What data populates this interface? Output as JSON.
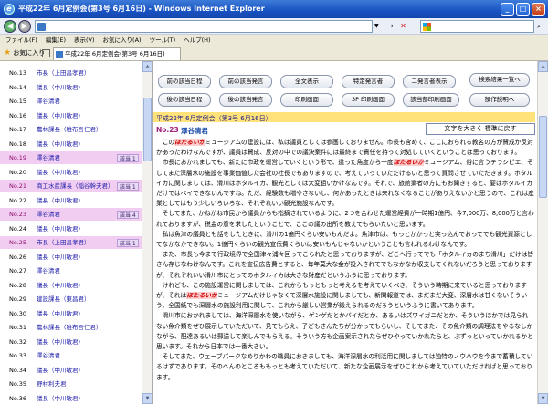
{
  "window": {
    "title": "平成22年 6月定例会(第3号 6月16日) - Windows Internet Explorer"
  },
  "address": {
    "url": ""
  },
  "menu": [
    "ファイル(F)",
    "編集(E)",
    "表示(V)",
    "お気に入り(A)",
    "ツール(T)",
    "ヘルプ(H)"
  ],
  "favorites": {
    "label": "お気に入り",
    "tab_title": "平成22年 6月定例会(第3号 6月16日)"
  },
  "sidebar": {
    "rows": [
      {
        "no": "No.13",
        "name": "市長（上田昌孝君）",
        "tag": ""
      },
      {
        "no": "No.14",
        "name": "議長（中川敏君）",
        "tag": ""
      },
      {
        "no": "No.15",
        "name": "澤谷清君",
        "tag": ""
      },
      {
        "no": "No.16",
        "name": "議長（中川敏君）",
        "tag": ""
      },
      {
        "no": "No.17",
        "name": "農林課長（稚布吾仁君）",
        "tag": ""
      },
      {
        "no": "No.18",
        "name": "議長（中川敏君）",
        "tag": ""
      },
      {
        "no": "No.19",
        "name": "澤谷清君",
        "tag": "該当 1"
      },
      {
        "no": "No.20",
        "name": "議長（中川敏君）",
        "tag": ""
      },
      {
        "no": "No.21",
        "name": "商工水産課長（稲谷幹夫君）",
        "tag": "該当 1"
      },
      {
        "no": "No.22",
        "name": "議長（中川敏君）",
        "tag": ""
      },
      {
        "no": "No.23",
        "name": "澤谷清君",
        "tag": "該当 4"
      },
      {
        "no": "No.24",
        "name": "議長（中川敏君）",
        "tag": ""
      },
      {
        "no": "No.25",
        "name": "市長（上田昌孝君）",
        "tag": "該当 1"
      },
      {
        "no": "No.26",
        "name": "議長（中川敏君）",
        "tag": ""
      },
      {
        "no": "No.27",
        "name": "澤谷清君",
        "tag": ""
      },
      {
        "no": "No.28",
        "name": "議長（中川敏君）",
        "tag": ""
      },
      {
        "no": "No.29",
        "name": "建設課長（東昌君）",
        "tag": ""
      },
      {
        "no": "No.30",
        "name": "議長（中川敏君）",
        "tag": ""
      },
      {
        "no": "No.31",
        "name": "農林課長（稚布吾仁君）",
        "tag": ""
      },
      {
        "no": "No.32",
        "name": "議長（中川敏君）",
        "tag": ""
      },
      {
        "no": "No.33",
        "name": "澤谷清君",
        "tag": ""
      },
      {
        "no": "No.34",
        "name": "議長（中川敏君）",
        "tag": ""
      },
      {
        "no": "No.35",
        "name": "野村利夫君",
        "tag": ""
      },
      {
        "no": "No.36",
        "name": "議長（中川敏君）",
        "tag": ""
      }
    ],
    "highlighted": [
      "No.19",
      "No.21",
      "No.23",
      "No.25"
    ]
  },
  "toolbar": {
    "prev_day": "前の該当日程",
    "prev_speaker": "前の該当発言",
    "show_all": "全文表示",
    "specific_speaker": "特定発言者",
    "two_speakers": "二発言者表示",
    "results_list": "検索結果一覧へ",
    "next_day": "後の該当日程",
    "next_speaker": "後の該当発言",
    "print_screen": "印刷画面",
    "print_all": "3P 印刷画面",
    "print_matched": "該当部印刷画面",
    "help": "操作説明へ"
  },
  "content": {
    "session": "平成22年 6月定例会（第3号 6月16日）",
    "speaker_no": "No.23",
    "speaker_name": "澤谷清君",
    "font_toggle": "文字を大きく 標準に戻す",
    "highlight_word": "ほたるいか",
    "paragraphs": [
      "この|ほたるいか|ミュージアムの建設には、私は議員としては参画しておりません。市長も含めて、ここにおられる教名の方が賛成か反対かあったわけなんですが、議員は賛成、反対の中での議決案件には最終まで責任を持って対処していくということは思っております。",
      "市長におかれましても、新たに市政を運営していくという形で、違った角度から一度|ほたるいか|ミュージアム、俗に言うテラシピエ、そしてまた深層水の施設を事業価値した会社の社長でもありますので、考えていっていただけるいと思って質問させていただきます。ホタルイカに関しましては、滑川はホタルイカ、観光としては大変狙いかけなんです。それで、旅館業者の方にもお聞きすると、要はホタルイカだけではペイできないんですね。ただ、経験数も増やさないし、何かあったときは来れなくなることがありえないかと思うので、これは産業としてはもう少しいろいろな、それぞれいい観光施設なんです。",
      "そしてまた、かねがね市民から議員からも指摘されているように、2つを合わせた運営経費が一時期1億円、今7,000万、8,000万と言われておりますが、税金の意を求したということで、ここの議の出所を教えてもらいたいと思います。",
      "私は魚津の議員とも話をしたときに、滑川の1億円くらい安いもんだよ。魚津市は、もっとかかっと突っ込んでおってでも観光資源としてなかなかできない。1億円くらいの観光宣伝費くらいは安いもんじゃないかということも言われるわけなんです。",
      "また、市長も今まで行政境界で全国津々浦々回ってこられたと思っておりますが、どこへ行ってでも「ホタルイカのまち滑川」だけは皆さん存じなわけなんです。これを宣伝広告費とすると、毎年莫大な金が投入されてでもなかなか収支してくれないだろうと思っておりますが、それぞれいい滑川市にとってのホタルイカは大きな財産だというふうに思っております。",
      "けれども、この施設運営に関しましては、これからもっともっと考えるを考えていくべき、そういう時期に来ていると思っておりますが、それは|ほたるいか|ミュージアムだけじゃなくて深層水施設に関しましても、新聞報道では、まだまだ大変、深層水は甘くないそういう、全国紙でも深層水の施設利用に関して、これから厳しい営業が鍛えられるのだろうというふうに書いてあります。",
      "滑川市におかれましては、海洋深層水を使いながら、ゲンゲだとかバイだとか、あるいはズワイガニだとか、そういうほかでは見られない魚介類をぜひ展示していただいて、見てもらえ、子どもさんたちが分かってもらいし、そしてまた、その魚介類の調理法をやるなしかながら、配達あるいは郵送して楽しんでもらえる。そういう方も企画案示されたらぜひやっていかれたらと、ぶずっといっていかれるかと思います。それから日本では一番大きい。",
      "そしてまた、ウェーブパークなめりかわの職員におきましても、海洋深層水の利活用に関しましては独特のノウハウを今まで蓄積しているはずであります。そのへんのところももっとも考えていただいて、新たな企画展示をぜひこれから考えていていただければと思っております。"
    ]
  }
}
